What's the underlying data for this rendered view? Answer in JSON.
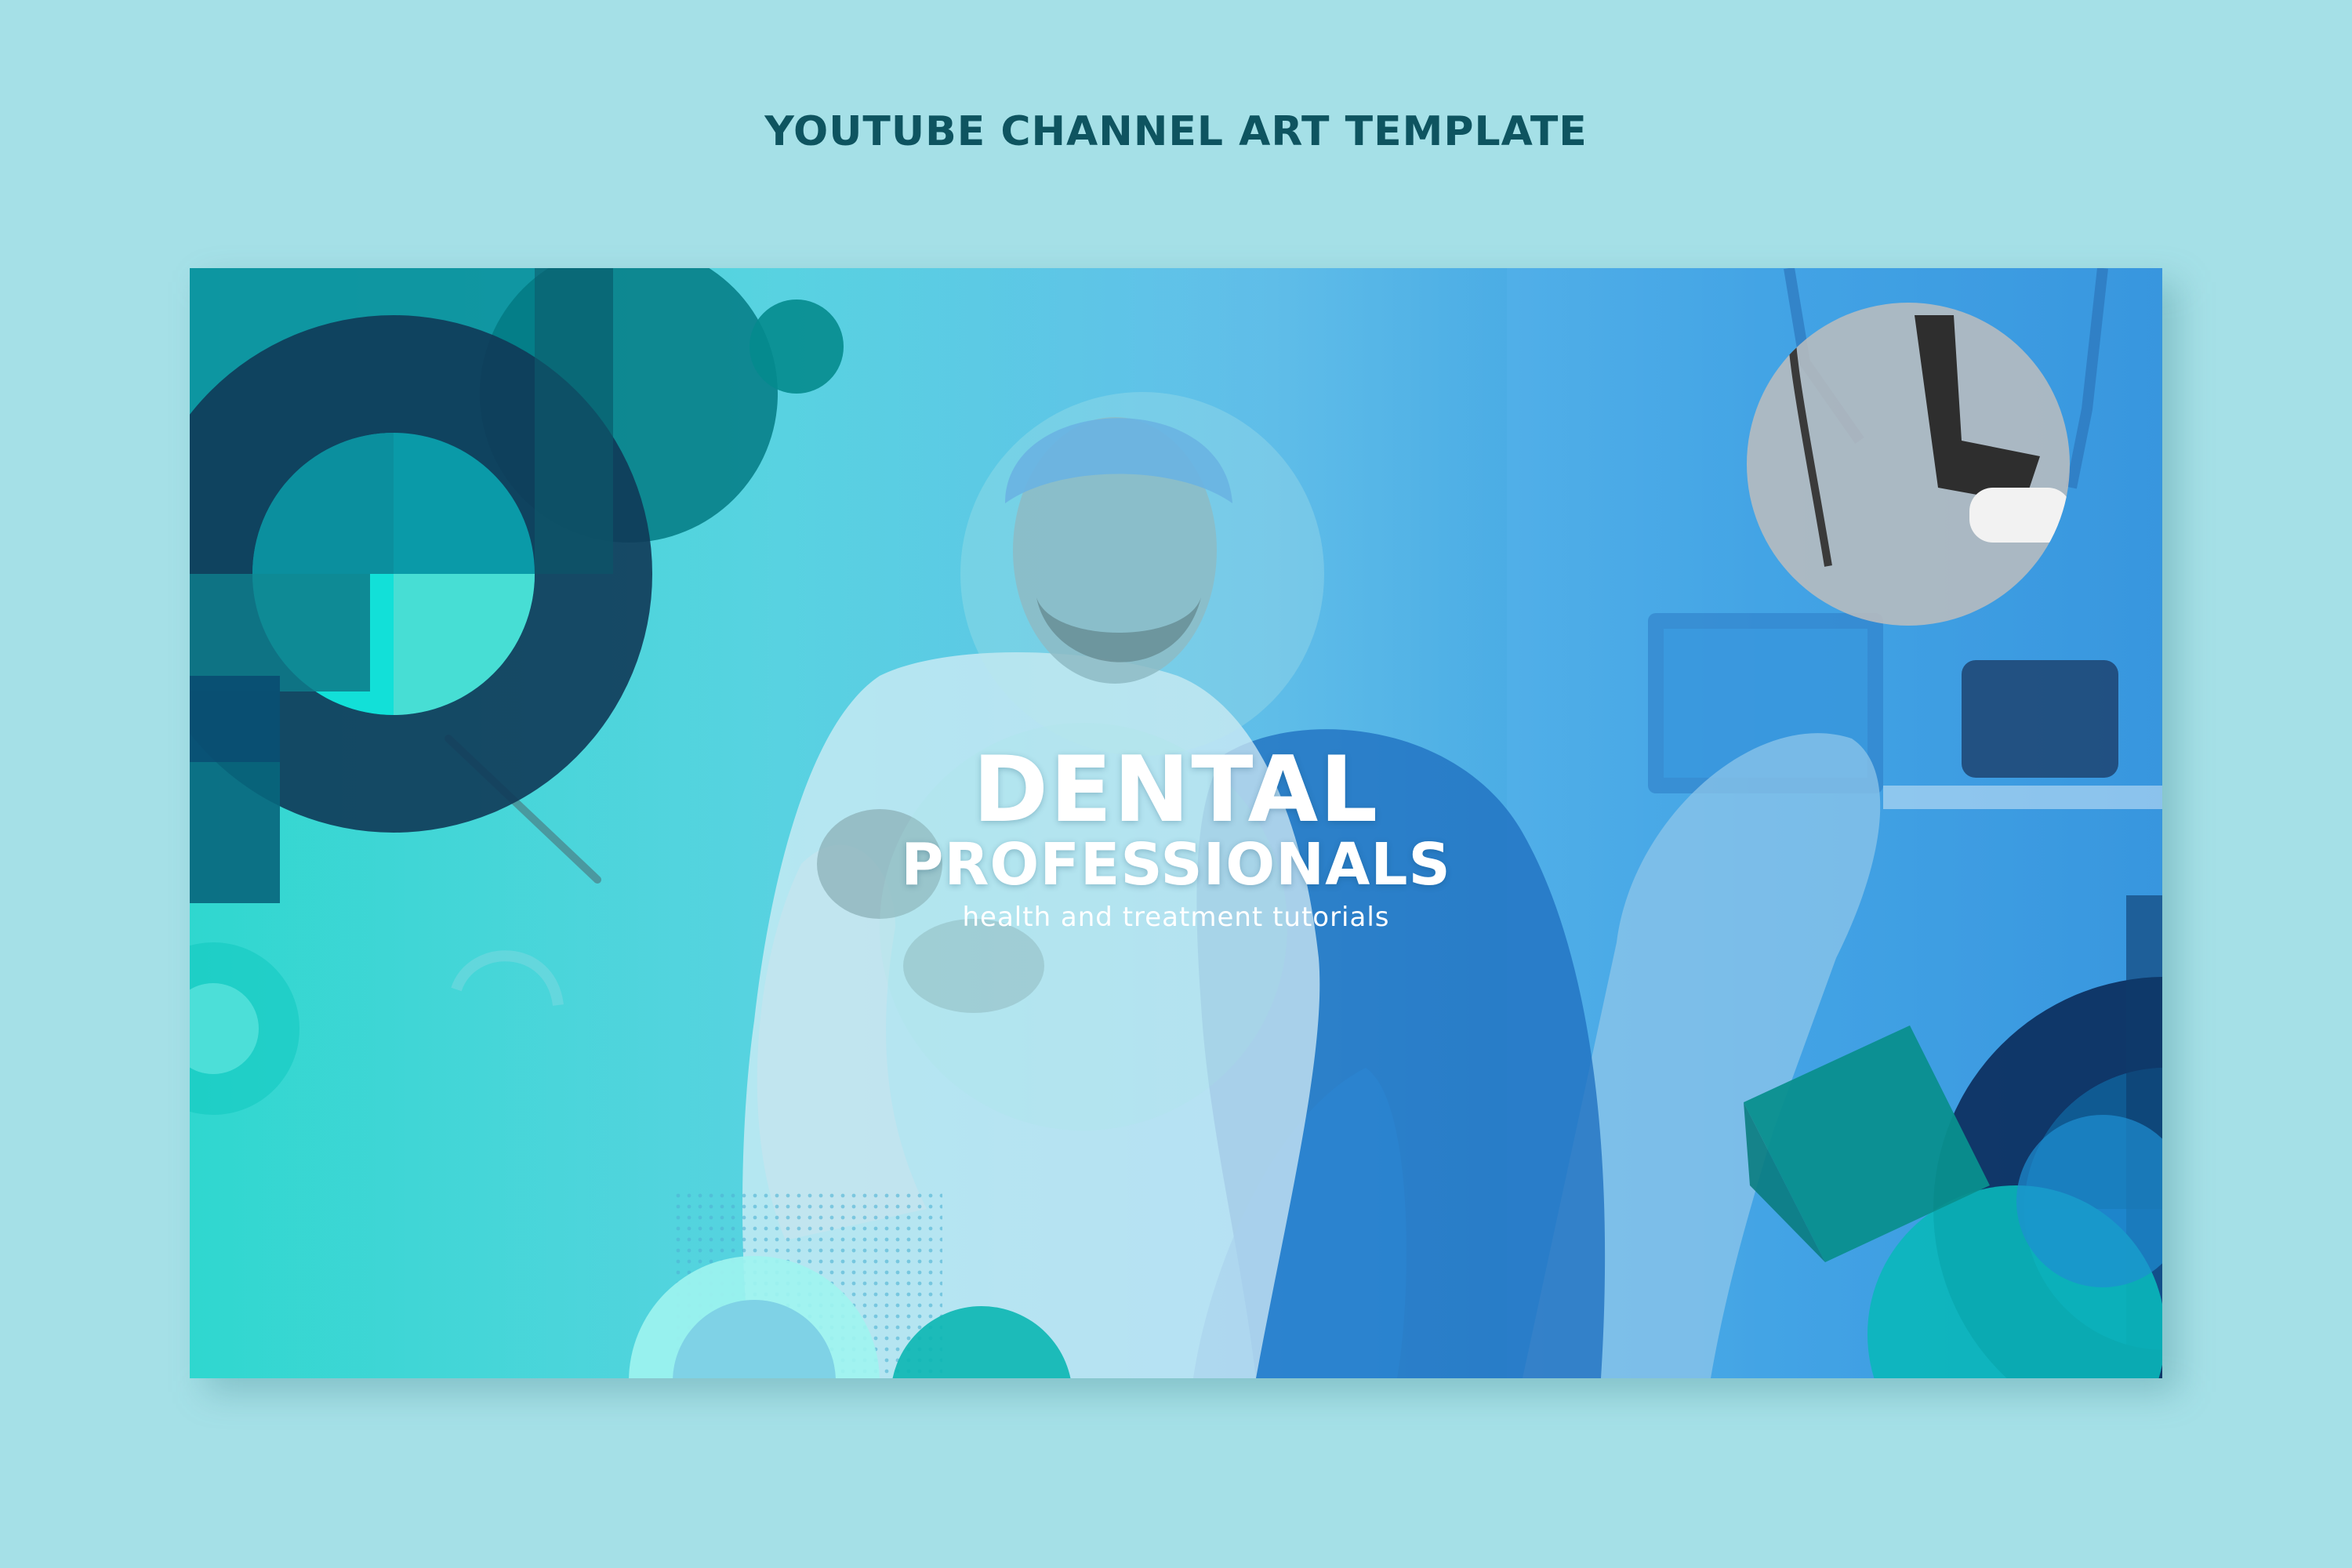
{
  "page": {
    "title": "YOUTUBE CHANNEL ART TEMPLATE"
  },
  "banner": {
    "headline_line1": "DENTAL",
    "headline_line2": "PROFESSIONALS",
    "tagline": "health and treatment tutorials"
  },
  "colors": {
    "background": "#a5e0e7",
    "title_text": "#0e5460",
    "banner_text": "#ffffff",
    "shape_dark_navy": "#103a58",
    "shape_teal": "#0a8c96",
    "shape_cyan": "#11e0d8"
  },
  "icons": {
    "halftone_pattern": "dot-grid-icon"
  }
}
